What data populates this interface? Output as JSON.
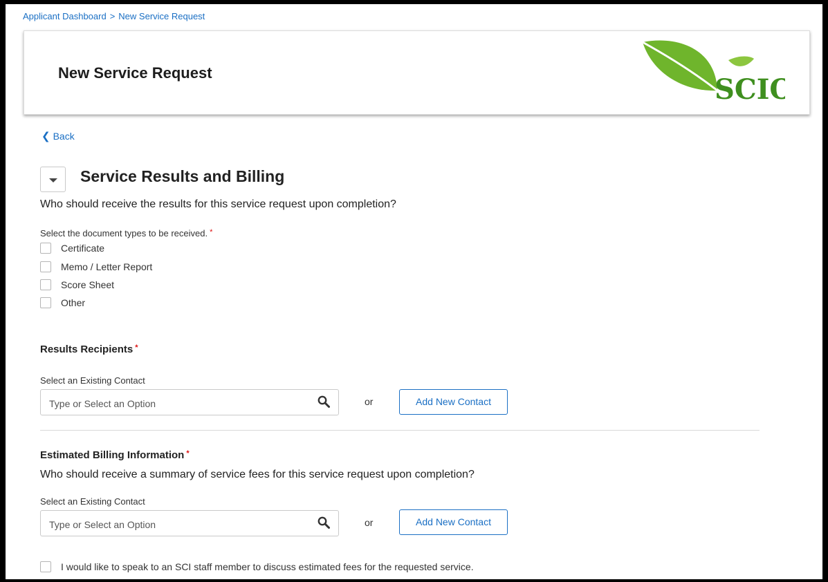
{
  "breadcrumb": {
    "items": [
      "Applicant Dashboard",
      "New Service Request"
    ],
    "separator": ">"
  },
  "header": {
    "title": "New Service Request",
    "logo_text": "SCION"
  },
  "back_label": "Back",
  "section": {
    "title": "Service Results and Billing",
    "question": "Who should receive the results for this service request upon completion?"
  },
  "document_types": {
    "label": "Select the document types to be received.",
    "required_mark": "*",
    "options": [
      {
        "label": "Certificate",
        "checked": false
      },
      {
        "label": "Memo / Letter Report",
        "checked": false
      },
      {
        "label": "Score Sheet",
        "checked": false
      },
      {
        "label": "Other",
        "checked": false
      }
    ]
  },
  "results_recipients": {
    "heading": "Results Recipients",
    "required_mark": "*",
    "contact_label": "Select an Existing Contact",
    "placeholder": "Type or Select an Option",
    "or_text": "or",
    "add_button": "Add New Contact"
  },
  "billing": {
    "heading": "Estimated Billing Information",
    "required_mark": "*",
    "question": "Who should receive a summary of service fees for this service request upon completion?",
    "contact_label": "Select an Existing Contact",
    "placeholder": "Type or Select an Option",
    "or_text": "or",
    "add_button": "Add New Contact",
    "speak_checkbox_label": "I would like to speak to an SCI staff member to discuss estimated fees for the requested service.",
    "speak_checked": false
  },
  "colors": {
    "link": "#1a6fc4",
    "required": "#dd1111",
    "logo_green": "#3f8f1f",
    "leaf_light": "#8cc63f"
  },
  "icons": [
    "chevron-left-icon",
    "caret-down-icon",
    "search-icon",
    "leaf-icon"
  ]
}
